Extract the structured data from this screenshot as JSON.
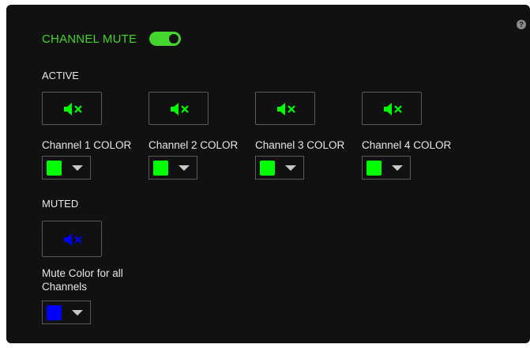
{
  "header": {
    "title": "CHANNEL MUTE",
    "toggle_on": true,
    "help_glyph": "?",
    "accent": "#44d62c"
  },
  "active": {
    "heading": "ACTIVE",
    "channels": [
      {
        "label": "Channel 1 COLOR",
        "color": "#00ff00",
        "icon": "speaker-mute-icon"
      },
      {
        "label": "Channel 2 COLOR",
        "color": "#00ff00",
        "icon": "speaker-mute-icon"
      },
      {
        "label": "Channel 3 COLOR",
        "color": "#00ff00",
        "icon": "speaker-mute-icon"
      },
      {
        "label": "Channel 4 COLOR",
        "color": "#00ff00",
        "icon": "speaker-mute-icon"
      }
    ]
  },
  "muted": {
    "heading": "MUTED",
    "label": "Mute Color for all Channels",
    "color": "#0000ff",
    "icon": "speaker-mute-icon"
  }
}
